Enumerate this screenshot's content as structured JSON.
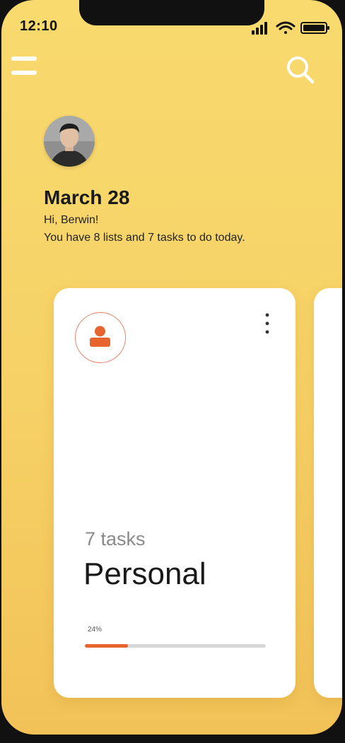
{
  "status_bar": {
    "time": "12:10",
    "icons": [
      "signal-icon",
      "wifi-icon",
      "battery-icon"
    ]
  },
  "header": {
    "menu_icon": "menu-icon",
    "search_icon": "search-icon"
  },
  "greeting": {
    "date": "March 28",
    "hello": "Hi, Berwin!",
    "summary": "You have 8 lists and 7 tasks to do today."
  },
  "cards": [
    {
      "icon": "person-icon",
      "count_label": "7 tasks",
      "title": "Personal",
      "progress_label": "24%",
      "progress": 0.24
    }
  ],
  "colors": {
    "background": "#f6d166",
    "accent": "#e8642f",
    "card": "#ffffff",
    "text": "#1a1a1a"
  }
}
